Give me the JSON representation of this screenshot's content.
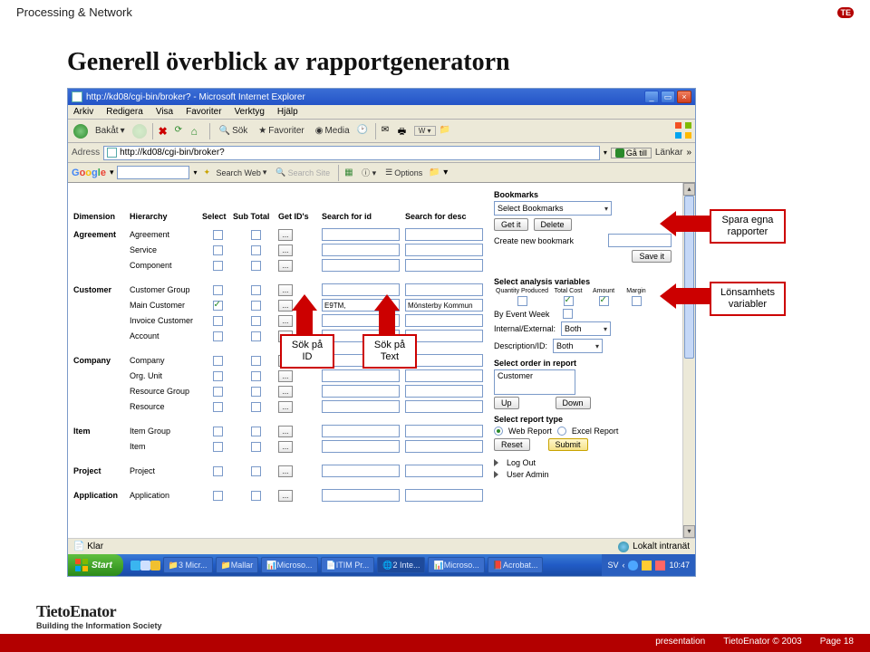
{
  "header": {
    "title": "Processing & Network",
    "badge": "TE"
  },
  "page_title": "Generell överblick av rapportgeneratorn",
  "browser": {
    "title": "http://kd08/cgi-bin/broker? - Microsoft Internet Explorer",
    "menus": [
      "Arkiv",
      "Redigera",
      "Visa",
      "Favoriter",
      "Verktyg",
      "Hjälp"
    ],
    "toolbar": {
      "back": "Bakåt",
      "search": "Sök",
      "favorites": "Favoriter",
      "media": "Media"
    },
    "address": {
      "label": "Adress",
      "value": "http://kd08/cgi-bin/broker?",
      "go": "Gå till",
      "links": "Länkar"
    },
    "google": {
      "search_web": "Search Web",
      "search_site": "Search Site",
      "options": "Options",
      "brand": "Google"
    },
    "status": {
      "left": "Klar",
      "right": "Lokalt intranät"
    }
  },
  "grid": {
    "headers": {
      "dimension": "Dimension",
      "hierarchy": "Hierarchy",
      "select": "Select",
      "subtotal": "Sub Total",
      "getids": "Get ID's",
      "searchid": "Search for id",
      "searchdesc": "Search for desc"
    },
    "groups": [
      {
        "label": "Agreement",
        "rows": [
          {
            "hier": "Agreement"
          },
          {
            "hier": "Service"
          },
          {
            "hier": "Component"
          }
        ]
      },
      {
        "label": "Customer",
        "rows": [
          {
            "hier": "Customer Group"
          },
          {
            "hier": "Main Customer",
            "checked": true,
            "id_val": "E9TM,",
            "desc_val": "Mönsterby Kommun"
          },
          {
            "hier": "Invoice Customer"
          },
          {
            "hier": "Account"
          }
        ]
      },
      {
        "label": "Company",
        "rows": [
          {
            "hier": "Company"
          },
          {
            "hier": "Org. Unit"
          },
          {
            "hier": "Resource Group"
          },
          {
            "hier": "Resource"
          }
        ]
      },
      {
        "label": "Item",
        "rows": [
          {
            "hier": "Item Group"
          },
          {
            "hier": "Item"
          }
        ]
      },
      {
        "label": "Project",
        "rows": [
          {
            "hier": "Project"
          }
        ]
      },
      {
        "label": "Application",
        "rows": [
          {
            "hier": "Application"
          }
        ]
      }
    ]
  },
  "right": {
    "bookmarks": {
      "title": "Bookmarks",
      "select": "Select Bookmarks",
      "getit": "Get it",
      "delete": "Delete",
      "create": "Create new bookmark",
      "saveit": "Save it"
    },
    "analysis": {
      "title": "Select analysis variables",
      "cols": [
        "Quantity Produced",
        "Total Cost",
        "Amount",
        "Margin"
      ],
      "checked": [
        false,
        true,
        true,
        false
      ],
      "byweek": "By Event Week",
      "intext_lbl": "Internal/External:",
      "intext_val": "Both",
      "descid_lbl": "Description/ID:",
      "descid_val": "Both"
    },
    "order": {
      "title": "Select order in report",
      "value": "Customer",
      "up": "Up",
      "down": "Down"
    },
    "report": {
      "title": "Select report type",
      "web": "Web Report",
      "excel": "Excel Report",
      "reset": "Reset",
      "submit": "Submit"
    },
    "logout": "Log Out",
    "useradmin": "User Admin"
  },
  "callouts": {
    "spara": "Spara egna\nrapporter",
    "lonsam": "Lönsamhets\nvariabler",
    "sokid": "Sök på\nID",
    "soktext": "Sök på\nText"
  },
  "taskbar": {
    "start": "Start",
    "tasks": [
      "3 Micr...",
      "Mallar",
      "Microso...",
      "ITIM Pr...",
      "2 Inte...",
      "Microso...",
      "Acrobat..."
    ],
    "lang": "SV",
    "clock": "10:47"
  },
  "footer": {
    "presentation": "presentation",
    "copyright": "TietoEnator © 2003",
    "page": "Page 18"
  },
  "brand": {
    "company": "TietoEnator",
    "tagline": "Building the Information Society"
  }
}
